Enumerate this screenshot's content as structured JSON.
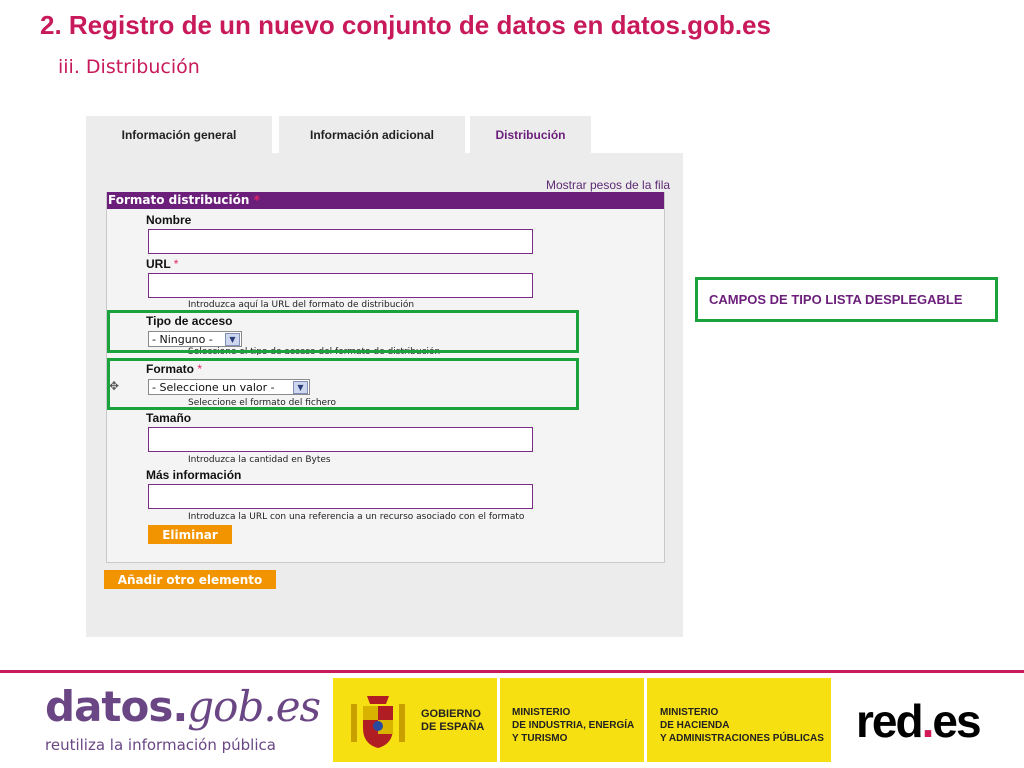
{
  "slide": {
    "title": "2. Registro de un nuevo conjunto de datos en datos.gob.es",
    "subtitle": "iii.  Distribución"
  },
  "tabs": [
    {
      "label": "Información general"
    },
    {
      "label": "Información adicional"
    },
    {
      "label": "Distribución"
    }
  ],
  "panel": {
    "row_weights_link": "Mostrar pesos de la fila",
    "section_title": "Formato distribución",
    "required_mark": "*"
  },
  "fields": {
    "nombre": {
      "label": "Nombre",
      "value": ""
    },
    "url": {
      "label": "URL",
      "value": "",
      "hint": "Introduzca aquí la URL del formato de distribución"
    },
    "tipo_acceso": {
      "label": "Tipo de acceso",
      "selected": "- Ninguno -",
      "hint": "Seleccione el tipo de acceso del formato de distribución"
    },
    "formato": {
      "label": "Formato",
      "selected": "- Seleccione un valor -",
      "hint": "Seleccione el formato del fichero"
    },
    "tamano": {
      "label": "Tamaño",
      "value": "",
      "hint": "Introduzca la cantidad en Bytes"
    },
    "mas_info": {
      "label": "Más información",
      "value": "",
      "hint": "Introduzca la URL con una referencia a un recurso asociado con el formato"
    }
  },
  "buttons": {
    "eliminar": "Eliminar",
    "anadir": "Añadir otro elemento"
  },
  "callout": "CAMPOS DE TIPO LISTA DESPLEGABLE",
  "footer": {
    "logo_part1": "datos.",
    "logo_part2": "gob.es",
    "logo_tagline": "reutiliza la información pública",
    "gobierno": "GOBIERNO\nDE ESPAÑA",
    "ministerio1": "MINISTERIO\nDE INDUSTRIA, ENERGÍA\nY TURISMO",
    "ministerio2": "MINISTERIO\nDE HACIENDA\nY ADMINISTRACIONES PÚBLICAS",
    "rede_part1": "red",
    "rede_dot": ".",
    "rede_part2": "es"
  },
  "colors": {
    "accent_magenta": "#c8195a",
    "purple": "#6b1f7a",
    "orange_button": "#f29400",
    "highlight_green": "#1aa33a",
    "gov_yellow": "#f7e012"
  }
}
